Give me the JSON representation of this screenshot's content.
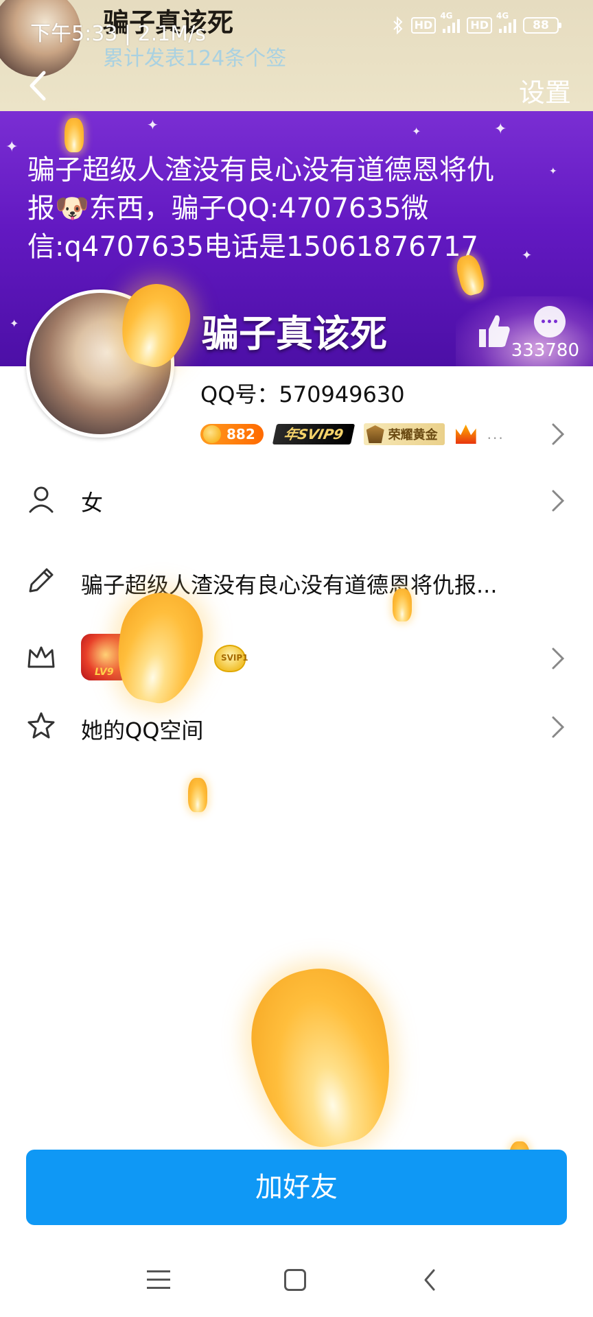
{
  "status_bar": {
    "time_info": "下午5:33 | 2.1M/s",
    "hd1": "HD",
    "net1": "4G",
    "hd2": "HD",
    "net2": "4G",
    "battery": "88"
  },
  "header": {
    "title": "骗子真该死",
    "subtitle": "累计发表124条个签",
    "settings_label": "设置"
  },
  "banner": {
    "signature": "骗子超级人渣没有良心没有道德恩将仇报🐶东西，骗子QQ:4707635微信:q4707635电话是15061876717",
    "nickname": "骗子真该死",
    "like_count": "333780"
  },
  "profile": {
    "qq_number": "QQ号：570949630",
    "coin_count": "882",
    "svip_label": "年SVIP9",
    "honor_label": "荣耀黄金",
    "more": "..."
  },
  "rows": {
    "gender": "女",
    "signature": "骗子超级人渣没有良心没有道德恩将仇报...",
    "vip_level": "LV9",
    "svip_level": "SVIP1",
    "qzone": "她的QQ空间"
  },
  "actions": {
    "add_friend": "加好友"
  },
  "colors": {
    "accent": "#0f98f5",
    "banner": "#6319c2",
    "header": "#e6dcc0"
  }
}
